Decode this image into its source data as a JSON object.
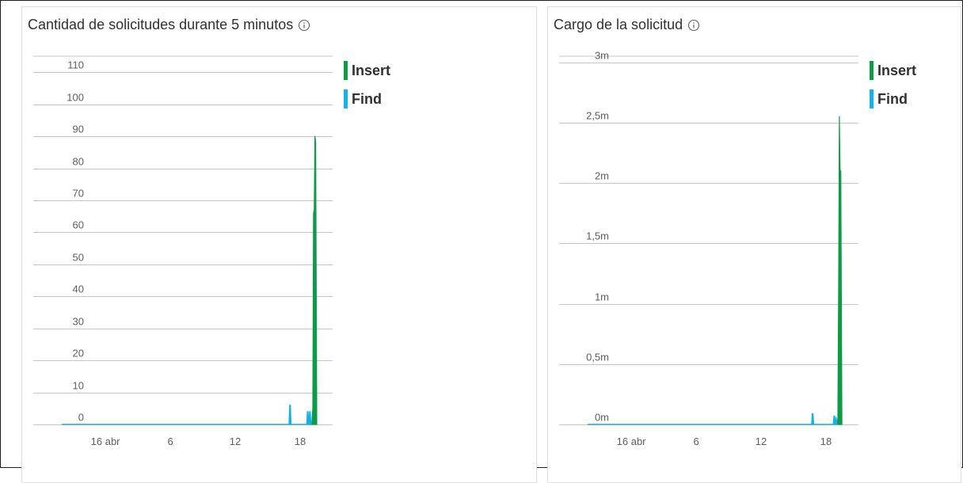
{
  "colors": {
    "insert": "#0d9b48",
    "find": "#14b2e6",
    "grid": "#c8c6c4",
    "axis_text": "#605e5c"
  },
  "tiles": [
    {
      "title": "Cantidad de solicitudes durante 5 minutos",
      "info_icon": "info-icon"
    },
    {
      "title": "Cargo de la solicitud",
      "info_icon": "info-icon"
    }
  ],
  "legend": {
    "insert": "Insert",
    "find": "Find"
  },
  "chart_data": [
    {
      "type": "area",
      "title": "Cantidad de solicitudes durante 5 minutos",
      "y_ticks": [
        0,
        10,
        20,
        30,
        40,
        50,
        60,
        70,
        80,
        90,
        100,
        110
      ],
      "y_tick_labels": [
        "0",
        "10",
        "20",
        "30",
        "40",
        "50",
        "60",
        "70",
        "80",
        "90",
        "100",
        "110"
      ],
      "ylim": [
        0,
        115
      ],
      "x_unit": "hours since 15 abr 12:00",
      "x_ticks": [
        12,
        30,
        48,
        66
      ],
      "x_tick_labels": [
        "16 abr",
        "6",
        "12",
        "18"
      ],
      "xlim": [
        -8,
        75
      ],
      "series": [
        {
          "name": "Insert",
          "x": [
            0,
            69.2,
            69.5,
            69.7,
            69.9,
            70.1,
            70.3,
            70.6
          ],
          "y": [
            0,
            0,
            5,
            66,
            67,
            90,
            88,
            0
          ]
        },
        {
          "name": "Find",
          "x": [
            0,
            62.9,
            63.1,
            63.3,
            63.5,
            67.8,
            68.0,
            68.2,
            68.4,
            68.6,
            68.8,
            69.0,
            69.2
          ],
          "y": [
            0,
            0,
            6,
            6,
            0,
            0,
            4,
            4,
            0,
            4,
            4,
            0,
            0
          ]
        }
      ]
    },
    {
      "type": "area",
      "title": "Cargo de la solicitud",
      "y_ticks": [
        0,
        0.5,
        1,
        1.5,
        2,
        2.5,
        3
      ],
      "y_tick_labels": [
        "0m",
        "0,5m",
        "1m",
        "1,5m",
        "2m",
        "2,5m",
        "3m"
      ],
      "ylim": [
        0,
        3.05
      ],
      "x_unit": "hours since 15 abr 12:00",
      "x_ticks": [
        12,
        30,
        48,
        66
      ],
      "x_tick_labels": [
        "16 abr",
        "6",
        "12",
        "18"
      ],
      "xlim": [
        -8,
        75
      ],
      "series": [
        {
          "name": "Insert",
          "x": [
            0,
            69.0,
            69.3,
            69.5,
            69.7,
            69.9,
            70.1,
            70.4
          ],
          "y": [
            0,
            0,
            0.05,
            1.2,
            2.55,
            2.1,
            2.1,
            0
          ]
        },
        {
          "name": "Find",
          "x": [
            0,
            62.0,
            62.2,
            62.4,
            62.6,
            68.0,
            68.2,
            68.4,
            68.6,
            68.8,
            69.0
          ],
          "y": [
            0,
            0,
            0.09,
            0.09,
            0,
            0,
            0.07,
            0.07,
            0,
            0.06,
            0
          ]
        }
      ]
    }
  ]
}
